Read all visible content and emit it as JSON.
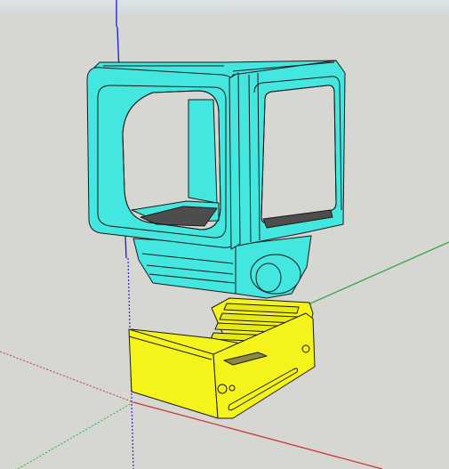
{
  "viewport": {
    "sky_top_color": "#dbe4ea",
    "sky_bottom_color": "#d4d4d2",
    "ground_color": "#d6d6d2"
  },
  "axes": {
    "blue_axis_color": "#2a2acc",
    "red_axis_color": "#c83838",
    "green_axis_color": "#3aa84a"
  },
  "model": {
    "camera_cage_color": "#44e6e0",
    "mount_base_color": "#f4f41c",
    "edge_color": "#1a1a1a",
    "shadow_color": "#4d4d4d"
  }
}
